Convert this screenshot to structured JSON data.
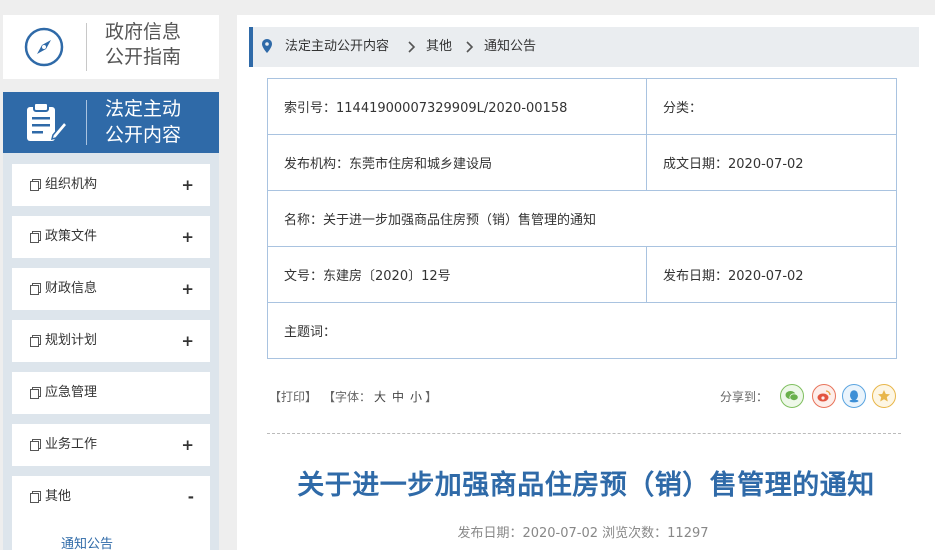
{
  "sidebar": {
    "guide_label_line1": "政府信息",
    "guide_label_line2": "公开指南",
    "section_label_line1": "法定主动",
    "section_label_line2": "公开内容",
    "items": [
      {
        "label": "组织机构",
        "toggle": "+"
      },
      {
        "label": "政策文件",
        "toggle": "+"
      },
      {
        "label": "财政信息",
        "toggle": "+"
      },
      {
        "label": "规划计划",
        "toggle": "+"
      },
      {
        "label": "应急管理",
        "toggle": ""
      },
      {
        "label": "业务工作",
        "toggle": "+"
      },
      {
        "label": "其他",
        "toggle": "-",
        "sub_item": "通知公告"
      }
    ]
  },
  "breadcrumb": {
    "items": [
      "法定主动公开内容",
      "其他",
      "通知公告"
    ],
    "separator": ">"
  },
  "meta": {
    "index_no_label": "索引号：",
    "index_no": "11441900007329909L/2020-00158",
    "category_label": "分类：",
    "category": "",
    "publisher_label": "发布机构：",
    "publisher": "东莞市住房和城乡建设局",
    "written_date_label": "成文日期：",
    "written_date": "2020-07-02",
    "name_label": "名称：",
    "name": "关于进一步加强商品住房预（销）售管理的通知",
    "doc_no_label": "文号：",
    "doc_no": "东建房〔2020〕12号",
    "publish_date_label": "发布日期：",
    "publish_date": "2020-07-02",
    "keywords_label": "主题词：",
    "keywords": ""
  },
  "tools": {
    "print": "【打印】",
    "font_prefix": "【字体：",
    "font_large": "大",
    "font_medium": "中",
    "font_small": "小",
    "font_suffix": "】",
    "share_label": "分享到：",
    "share_icons": [
      "wechat-icon",
      "weibo-icon",
      "qq-icon",
      "favorite-icon"
    ]
  },
  "article": {
    "title": "关于进一步加强商品住房预（销）售管理的通知",
    "publish_info": "发布日期：2020-07-02  浏览次数：11297"
  },
  "colors": {
    "accent": "#2f6aa8",
    "table_border": "#a9c3e0",
    "page_bg": "#eeeeee",
    "menu_bg": "#dde5ec"
  }
}
